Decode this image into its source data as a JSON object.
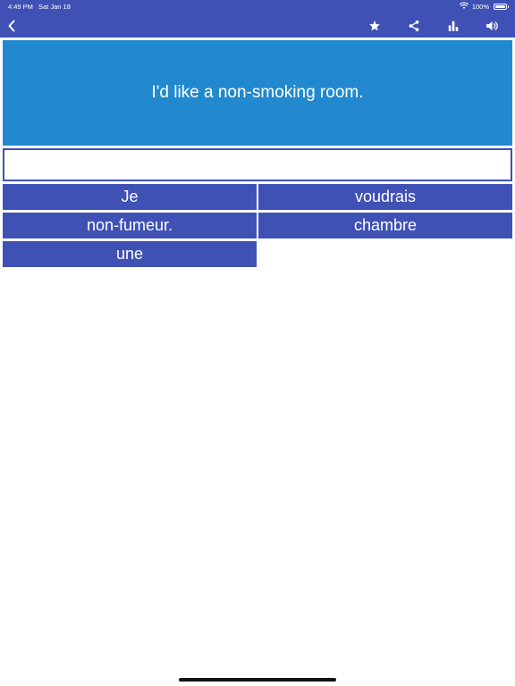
{
  "status_bar": {
    "time": "4:49 PM",
    "date": "Sat Jan 18",
    "battery_percent": "100%",
    "battery_level": 1.0
  },
  "nav": {
    "back_icon": "chevron-left-icon",
    "actions": [
      "star-icon",
      "share-icon",
      "bar-chart-icon",
      "speaker-icon"
    ]
  },
  "exercise": {
    "prompt": "I'd like a non-smoking room.",
    "answer": "",
    "word_tiles": [
      "Je",
      "voudrais",
      "non-fumeur.",
      "chambre",
      "une"
    ]
  },
  "colors": {
    "primary": "#3f51b5",
    "prompt_background": "#2289ce",
    "text_on_primary": "#ffffff"
  }
}
